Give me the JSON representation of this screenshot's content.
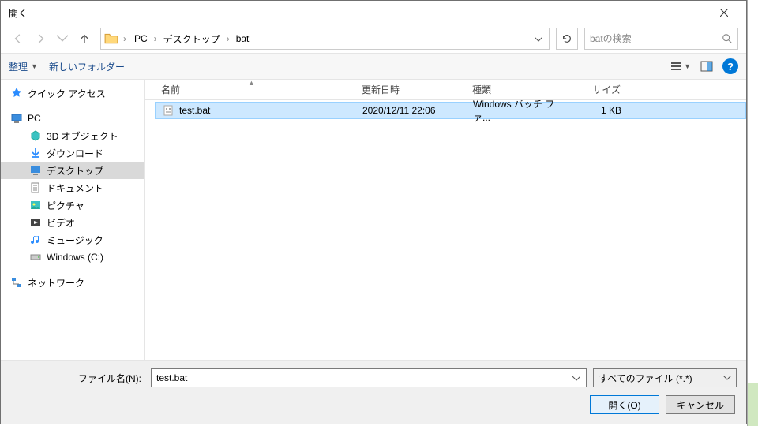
{
  "window": {
    "title": "開く"
  },
  "nav": {
    "breadcrumb": [
      "PC",
      "デスクトップ",
      "bat"
    ],
    "search_placeholder": "batの検索"
  },
  "toolbar": {
    "organize": "整理",
    "new_folder": "新しいフォルダー"
  },
  "sidebar": {
    "quick_access": "クイック アクセス",
    "pc": "PC",
    "children": [
      {
        "id": "3d",
        "label": "3D オブジェクト"
      },
      {
        "id": "downloads",
        "label": "ダウンロード"
      },
      {
        "id": "desktop",
        "label": "デスクトップ",
        "selected": true
      },
      {
        "id": "documents",
        "label": "ドキュメント"
      },
      {
        "id": "pictures",
        "label": "ピクチャ"
      },
      {
        "id": "videos",
        "label": "ビデオ"
      },
      {
        "id": "music",
        "label": "ミュージック"
      },
      {
        "id": "cdrive",
        "label": "Windows (C:)"
      }
    ],
    "network": "ネットワーク"
  },
  "columns": {
    "name": "名前",
    "date": "更新日時",
    "type": "種類",
    "size": "サイズ"
  },
  "files": [
    {
      "name": "test.bat",
      "date": "2020/12/11 22:06",
      "type": "Windows バッチ ファ...",
      "size": "1 KB",
      "selected": true
    }
  ],
  "footer": {
    "filename_label": "ファイル名(N):",
    "filename_value": "test.bat",
    "filter_label": "すべてのファイル (*.*)",
    "open_btn": "開く(O)",
    "cancel_btn": "キャンセル"
  }
}
